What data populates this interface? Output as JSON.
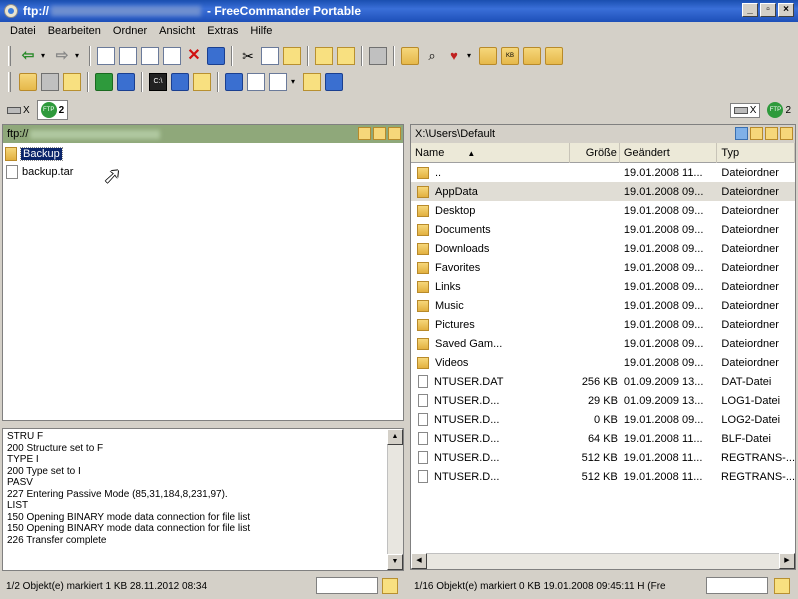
{
  "window": {
    "title_prefix": "ftp://",
    "title_suffix": "- FreeCommander Portable"
  },
  "menu": [
    "Datei",
    "Bearbeiten",
    "Ordner",
    "Ansicht",
    "Extras",
    "Hilfe"
  ],
  "drives": {
    "left": [
      {
        "label": "X"
      },
      {
        "label": "2"
      }
    ],
    "right": [
      {
        "label": "X"
      },
      {
        "label": "2"
      }
    ]
  },
  "left_panel": {
    "path": "ftp://",
    "items": [
      {
        "name": "Backup",
        "kind": "folder",
        "selected": true
      },
      {
        "name": "backup.tar",
        "kind": "file",
        "selected": false
      }
    ]
  },
  "log_lines": [
    "STRU F",
    "200 Structure set to F",
    "TYPE I",
    "200 Type set to I",
    "PASV",
    "227 Entering Passive Mode (85,31,184,8,231,97).",
    "LIST",
    "150 Opening BINARY mode data connection for file list",
    "150 Opening BINARY mode data connection for file list",
    "226 Transfer complete"
  ],
  "right_panel": {
    "path": "X:\\Users\\Default",
    "columns": {
      "name": "Name",
      "size": "Größe",
      "date": "Geändert",
      "type": "Typ"
    },
    "rows": [
      {
        "name": "..",
        "size": "",
        "date": "19.01.2008 11...",
        "type": "Dateiordner",
        "kind": "folder",
        "hl": false
      },
      {
        "name": "AppData",
        "size": "",
        "date": "19.01.2008 09...",
        "type": "Dateiordner",
        "kind": "folder",
        "hl": true
      },
      {
        "name": "Desktop",
        "size": "",
        "date": "19.01.2008 09...",
        "type": "Dateiordner",
        "kind": "folder",
        "hl": false
      },
      {
        "name": "Documents",
        "size": "",
        "date": "19.01.2008 09...",
        "type": "Dateiordner",
        "kind": "folder",
        "hl": false
      },
      {
        "name": "Downloads",
        "size": "",
        "date": "19.01.2008 09...",
        "type": "Dateiordner",
        "kind": "folder",
        "hl": false
      },
      {
        "name": "Favorites",
        "size": "",
        "date": "19.01.2008 09...",
        "type": "Dateiordner",
        "kind": "folder",
        "hl": false
      },
      {
        "name": "Links",
        "size": "",
        "date": "19.01.2008 09...",
        "type": "Dateiordner",
        "kind": "folder",
        "hl": false
      },
      {
        "name": "Music",
        "size": "",
        "date": "19.01.2008 09...",
        "type": "Dateiordner",
        "kind": "folder",
        "hl": false
      },
      {
        "name": "Pictures",
        "size": "",
        "date": "19.01.2008 09...",
        "type": "Dateiordner",
        "kind": "folder",
        "hl": false
      },
      {
        "name": "Saved Gam...",
        "size": "",
        "date": "19.01.2008 09...",
        "type": "Dateiordner",
        "kind": "folder",
        "hl": false
      },
      {
        "name": "Videos",
        "size": "",
        "date": "19.01.2008 09...",
        "type": "Dateiordner",
        "kind": "folder",
        "hl": false
      },
      {
        "name": "NTUSER.DAT",
        "size": "256 KB",
        "date": "01.09.2009 13...",
        "type": "DAT-Datei",
        "kind": "file",
        "hl": false
      },
      {
        "name": "NTUSER.D...",
        "size": "29 KB",
        "date": "01.09.2009 13...",
        "type": "LOG1-Datei",
        "kind": "file",
        "hl": false
      },
      {
        "name": "NTUSER.D...",
        "size": "0 KB",
        "date": "19.01.2008 09...",
        "type": "LOG2-Datei",
        "kind": "file",
        "hl": false
      },
      {
        "name": "NTUSER.D...",
        "size": "64 KB",
        "date": "19.01.2008 11...",
        "type": "BLF-Datei",
        "kind": "file",
        "hl": false
      },
      {
        "name": "NTUSER.D...",
        "size": "512 KB",
        "date": "19.01.2008 11...",
        "type": "REGTRANS-...",
        "kind": "file",
        "hl": false
      },
      {
        "name": "NTUSER.D...",
        "size": "512 KB",
        "date": "19.01.2008 11...",
        "type": "REGTRANS-...",
        "kind": "file",
        "hl": false
      }
    ]
  },
  "status": {
    "left": "1/2 Objekt(e) markiert   1 KB  28.11.2012 08:34",
    "right": "1/16 Objekt(e) markiert   0 KB  19.01.2008 09:45:11  H  (Fre"
  }
}
